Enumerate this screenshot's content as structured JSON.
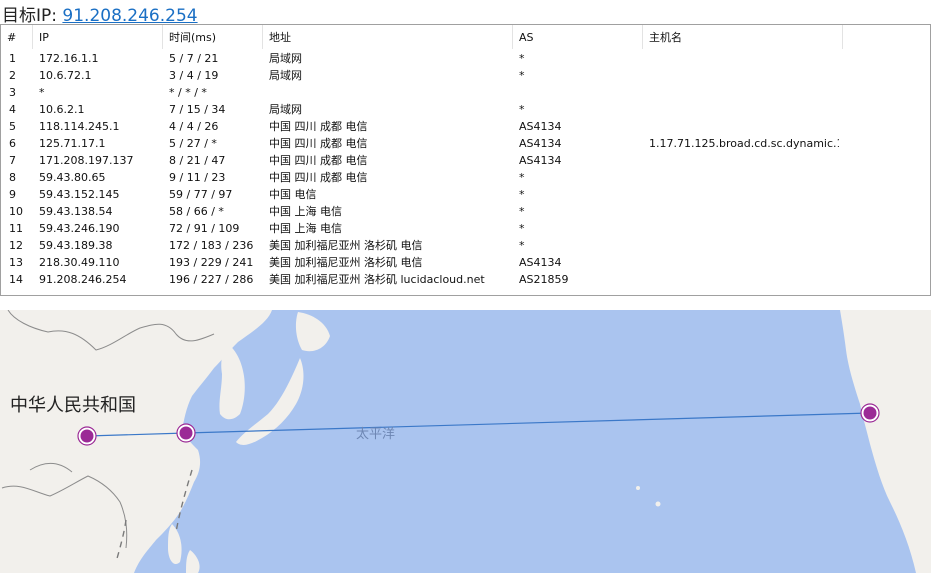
{
  "title": {
    "label": "目标IP: ",
    "ip": "91.208.246.254"
  },
  "table": {
    "headers": [
      "#",
      "IP",
      "时间(ms)",
      "地址",
      "AS",
      "主机名"
    ],
    "rows": [
      {
        "n": "1",
        "ip": "172.16.1.1",
        "time": "5 / 7 / 21",
        "addr": "局域网",
        "as": "*",
        "host": ""
      },
      {
        "n": "2",
        "ip": "10.6.72.1",
        "time": "3 / 4 / 19",
        "addr": "局域网",
        "as": "*",
        "host": ""
      },
      {
        "n": "3",
        "ip": "*",
        "time": "* / * / *",
        "addr": "",
        "as": "",
        "host": ""
      },
      {
        "n": "4",
        "ip": "10.6.2.1",
        "time": "7 / 15 / 34",
        "addr": "局域网",
        "as": "*",
        "host": ""
      },
      {
        "n": "5",
        "ip": "118.114.245.1",
        "time": "4 / 4 / 26",
        "addr": "中国 四川 成都 电信",
        "as": "AS4134",
        "host": ""
      },
      {
        "n": "6",
        "ip": "125.71.17.1",
        "time": "5 / 27 / *",
        "addr": "中国 四川 成都 电信",
        "as": "AS4134",
        "host": "1.17.71.125.broad.cd.sc.dynamic.1..."
      },
      {
        "n": "7",
        "ip": "171.208.197.137",
        "time": "8 / 21 / 47",
        "addr": "中国 四川 成都 电信",
        "as": "AS4134",
        "host": ""
      },
      {
        "n": "8",
        "ip": "59.43.80.65",
        "time": "9 / 11 / 23",
        "addr": "中国 四川 成都 电信",
        "as": "*",
        "host": ""
      },
      {
        "n": "9",
        "ip": "59.43.152.145",
        "time": "59 / 77 / 97",
        "addr": "中国 电信",
        "as": "*",
        "host": ""
      },
      {
        "n": "10",
        "ip": "59.43.138.54",
        "time": "58 / 66 / *",
        "addr": "中国 上海 电信",
        "as": "*",
        "host": ""
      },
      {
        "n": "11",
        "ip": "59.43.246.190",
        "time": "72 / 91 / 109",
        "addr": "中国 上海 电信",
        "as": "*",
        "host": ""
      },
      {
        "n": "12",
        "ip": "59.43.189.38",
        "time": "172 / 183 / 236",
        "addr": "美国 加利福尼亚州 洛杉矶 电信",
        "as": "*",
        "host": ""
      },
      {
        "n": "13",
        "ip": "218.30.49.110",
        "time": "193 / 229 / 241",
        "addr": "美国 加利福尼亚州 洛杉矶 电信",
        "as": "AS4134",
        "host": ""
      },
      {
        "n": "14",
        "ip": "91.208.246.254",
        "time": "196 / 227 / 286",
        "addr": "美国 加利福尼亚州 洛杉矶 lucidacloud.net",
        "as": "AS21859",
        "host": ""
      }
    ]
  },
  "map": {
    "country_label": "中华人民共和国",
    "ocean_label": "太平洋",
    "hops": [
      "Chengdu",
      "Shanghai",
      "Los Angeles"
    ],
    "colors": {
      "water": "#aac4ef",
      "land": "#f2f0ec",
      "route": "#3b78c8",
      "marker": "#9b2a96"
    }
  }
}
